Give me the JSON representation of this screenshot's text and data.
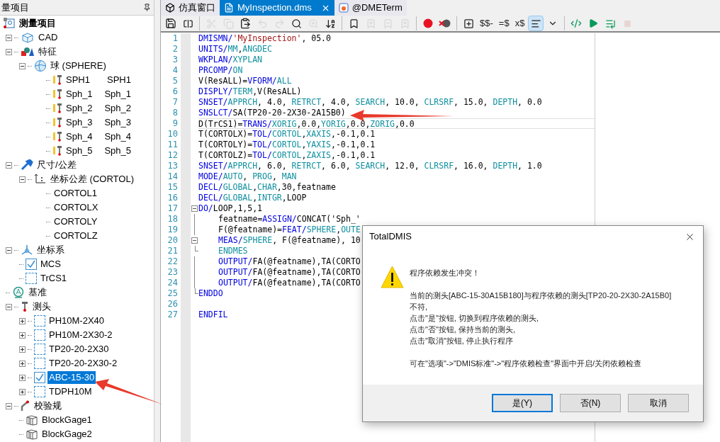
{
  "panel": {
    "title": "量项目"
  },
  "tree": [
    {
      "label": "测量项目",
      "kind": "project",
      "children": [
        {
          "label": "CAD",
          "kind": "cad",
          "expanded": true
        },
        {
          "label": "特征",
          "kind": "feature",
          "expanded": true,
          "children": [
            {
              "label": "球 (SPHERE)",
              "kind": "sphere",
              "expanded": true,
              "children": [
                {
                  "label": "SPH1",
                  "alias": "SPH1",
                  "kind": "point"
                },
                {
                  "label": "Sph_1",
                  "alias": "Sph_1",
                  "kind": "point"
                },
                {
                  "label": "Sph_2",
                  "alias": "Sph_2",
                  "kind": "point"
                },
                {
                  "label": "Sph_3",
                  "alias": "Sph_3",
                  "kind": "point"
                },
                {
                  "label": "Sph_4",
                  "alias": "Sph_4",
                  "kind": "point"
                },
                {
                  "label": "Sph_5",
                  "alias": "Sph_5",
                  "kind": "point"
                }
              ]
            }
          ]
        },
        {
          "label": "尺寸/公差",
          "kind": "tolerance",
          "expanded": true,
          "children": [
            {
              "label": "坐标公差 (CORTOL)",
              "kind": "cortol",
              "expanded": true,
              "children": [
                {
                  "label": "CORTOL1",
                  "kind": "leaf"
                },
                {
                  "label": "CORTOLX",
                  "kind": "leaf"
                },
                {
                  "label": "CORTOLY",
                  "kind": "leaf"
                },
                {
                  "label": "CORTOLZ",
                  "kind": "leaf"
                }
              ]
            }
          ]
        },
        {
          "label": "坐标系",
          "kind": "csys",
          "expanded": true,
          "children": [
            {
              "label": "MCS",
              "kind": "check",
              "checked": true,
              "selected": false
            },
            {
              "label": "TrCS1",
              "kind": "check",
              "checked": false,
              "selected": false
            }
          ]
        },
        {
          "label": "基准",
          "kind": "datum"
        },
        {
          "label": "测头",
          "kind": "probe",
          "expanded": true,
          "children": [
            {
              "label": "PH10M-2X40",
              "kind": "check",
              "checked": false,
              "expanded": false,
              "selected": false
            },
            {
              "label": "PH10M-2X30-2",
              "kind": "check",
              "checked": false,
              "expanded": false,
              "selected": false
            },
            {
              "label": "TP20-20-2X30",
              "kind": "check",
              "checked": false,
              "expanded": false,
              "selected": false
            },
            {
              "label": "TP20-20-2X30-2",
              "kind": "check",
              "checked": false,
              "expanded": false,
              "selected": false
            },
            {
              "label": "ABC-15-30",
              "kind": "check",
              "checked": true,
              "expanded": false,
              "selected": true
            },
            {
              "label": "TDPH10M",
              "kind": "check",
              "checked": false,
              "expanded": false,
              "selected": false
            }
          ]
        },
        {
          "label": "校验规",
          "kind": "gauge",
          "expanded": true,
          "children": [
            {
              "label": "BlockGage1",
              "kind": "block"
            },
            {
              "label": "BlockGage2",
              "kind": "block"
            }
          ]
        }
      ]
    }
  ],
  "tabs": [
    {
      "label": "仿真窗口",
      "kind": "sim",
      "selected": false
    },
    {
      "label": "MyInspection.dms",
      "kind": "doc",
      "selected": true,
      "closable": true
    },
    {
      "label": "@DMETerm",
      "kind": "term",
      "selected": false
    }
  ],
  "toolbar": [
    {
      "kind": "save",
      "disabled": false
    },
    {
      "kind": "compare",
      "disabled": false
    },
    {
      "kind": "sep"
    },
    {
      "kind": "cut",
      "disabled": true
    },
    {
      "kind": "copy",
      "disabled": true
    },
    {
      "kind": "paste",
      "disabled": false
    },
    {
      "kind": "undo",
      "disabled": true
    },
    {
      "kind": "redo",
      "disabled": true
    },
    {
      "kind": "find",
      "disabled": false
    },
    {
      "kind": "findnext",
      "disabled": true
    },
    {
      "kind": "sort",
      "disabled": false
    },
    {
      "kind": "sep"
    },
    {
      "kind": "bookmark",
      "disabled": false
    },
    {
      "kind": "bmprev",
      "disabled": true
    },
    {
      "kind": "bmnext",
      "disabled": true
    },
    {
      "kind": "bmclear",
      "disabled": true
    },
    {
      "kind": "sep"
    },
    {
      "kind": "record",
      "disabled": false
    },
    {
      "kind": "bpdelete",
      "disabled": false
    },
    {
      "kind": "sep"
    },
    {
      "kind": "insert",
      "disabled": false
    },
    {
      "kind": "text",
      "label": "$$-",
      "disabled": false
    },
    {
      "kind": "text",
      "label": "=$",
      "disabled": false
    },
    {
      "kind": "text",
      "label": "x$",
      "disabled": false
    },
    {
      "kind": "align",
      "disabled": false,
      "active": true
    },
    {
      "kind": "dropdown",
      "disabled": false
    },
    {
      "kind": "sep"
    },
    {
      "kind": "code",
      "disabled": false
    },
    {
      "kind": "play",
      "disabled": false
    },
    {
      "kind": "step",
      "disabled": false
    },
    {
      "kind": "stop",
      "disabled": true
    }
  ],
  "code": [
    {
      "n": "1",
      "tokens": [
        {
          "t": "DMISMN/",
          "kind": "kw"
        },
        {
          "t": "'MyInspection'",
          "kind": "str"
        },
        {
          "t": ", 05.0",
          "kind": "p"
        }
      ]
    },
    {
      "n": "2",
      "tokens": [
        {
          "t": "UNITS/",
          "kind": "kw"
        },
        {
          "t": "MM",
          "kind": "at"
        },
        {
          "t": ",",
          "kind": "p"
        },
        {
          "t": "ANGDEC",
          "kind": "at"
        }
      ]
    },
    {
      "n": "3",
      "tokens": [
        {
          "t": "WKPLAN/",
          "kind": "kw"
        },
        {
          "t": "XYPLAN",
          "kind": "at"
        }
      ]
    },
    {
      "n": "4",
      "tokens": [
        {
          "t": "PRCOMP/",
          "kind": "kw"
        },
        {
          "t": "ON",
          "kind": "at"
        }
      ]
    },
    {
      "n": "5",
      "tokens": [
        {
          "t": "V(ResALL)=",
          "kind": "p"
        },
        {
          "t": "VFORM/",
          "kind": "kw"
        },
        {
          "t": "ALL",
          "kind": "at"
        }
      ]
    },
    {
      "n": "6",
      "tokens": [
        {
          "t": "DISPLY/",
          "kind": "kw"
        },
        {
          "t": "TERM",
          "kind": "at"
        },
        {
          "t": ",V(ResALL)",
          "kind": "p"
        }
      ]
    },
    {
      "n": "7",
      "tokens": [
        {
          "t": "SNSET/",
          "kind": "kw"
        },
        {
          "t": "APPRCH",
          "kind": "at"
        },
        {
          "t": ", 4.0, ",
          "kind": "p"
        },
        {
          "t": "RETRCT",
          "kind": "at"
        },
        {
          "t": ", 4.0, ",
          "kind": "p"
        },
        {
          "t": "SEARCH",
          "kind": "at"
        },
        {
          "t": ", 10.0, ",
          "kind": "p"
        },
        {
          "t": "CLRSRF",
          "kind": "at"
        },
        {
          "t": ", 15.0, ",
          "kind": "p"
        },
        {
          "t": "DEPTH",
          "kind": "at"
        },
        {
          "t": ", 0.0",
          "kind": "p"
        }
      ]
    },
    {
      "n": "8",
      "tokens": [
        {
          "t": "SNSLCT/",
          "kind": "kw"
        },
        {
          "t": "SA(TP20-20-2X30-2A15B0)",
          "kind": "p"
        }
      ]
    },
    {
      "n": "9",
      "current": true,
      "tokens": [
        {
          "t": "D(TrCS1)=",
          "kind": "p"
        },
        {
          "t": "TRANS/",
          "kind": "kw"
        },
        {
          "t": "XORIG",
          "kind": "at"
        },
        {
          "t": ",0.0,",
          "kind": "p"
        },
        {
          "t": "YORIG",
          "kind": "at"
        },
        {
          "t": ",0.0,",
          "kind": "p"
        },
        {
          "t": "ZORIG",
          "kind": "at"
        },
        {
          "t": ",0.0",
          "kind": "p"
        }
      ]
    },
    {
      "n": "10",
      "tokens": [
        {
          "t": "T(CORTOLX)=",
          "kind": "p"
        },
        {
          "t": "TOL/",
          "kind": "kw"
        },
        {
          "t": "CORTOL",
          "kind": "at"
        },
        {
          "t": ",",
          "kind": "p"
        },
        {
          "t": "XAXIS",
          "kind": "at"
        },
        {
          "t": ",-0.1,0.1",
          "kind": "p"
        }
      ]
    },
    {
      "n": "11",
      "tokens": [
        {
          "t": "T(CORTOLY)=",
          "kind": "p"
        },
        {
          "t": "TOL/",
          "kind": "kw"
        },
        {
          "t": "CORTOL",
          "kind": "at"
        },
        {
          "t": ",",
          "kind": "p"
        },
        {
          "t": "YAXIS",
          "kind": "at"
        },
        {
          "t": ",-0.1,0.1",
          "kind": "p"
        }
      ]
    },
    {
      "n": "12",
      "tokens": [
        {
          "t": "T(CORTOLZ)=",
          "kind": "p"
        },
        {
          "t": "TOL/",
          "kind": "kw"
        },
        {
          "t": "CORTOL",
          "kind": "at"
        },
        {
          "t": ",",
          "kind": "p"
        },
        {
          "t": "ZAXIS",
          "kind": "at"
        },
        {
          "t": ",-0.1,0.1",
          "kind": "p"
        }
      ]
    },
    {
      "n": "13",
      "tokens": [
        {
          "t": "SNSET/",
          "kind": "kw"
        },
        {
          "t": "APPRCH",
          "kind": "at"
        },
        {
          "t": ", 6.0, ",
          "kind": "p"
        },
        {
          "t": "RETRCT",
          "kind": "at"
        },
        {
          "t": ", 6.0, ",
          "kind": "p"
        },
        {
          "t": "SEARCH",
          "kind": "at"
        },
        {
          "t": ", 12.0, ",
          "kind": "p"
        },
        {
          "t": "CLRSRF",
          "kind": "at"
        },
        {
          "t": ", 16.0, ",
          "kind": "p"
        },
        {
          "t": "DEPTH",
          "kind": "at"
        },
        {
          "t": ", 1.0",
          "kind": "p"
        }
      ]
    },
    {
      "n": "14",
      "tokens": [
        {
          "t": "MODE/",
          "kind": "kw"
        },
        {
          "t": "AUTO",
          "kind": "at"
        },
        {
          "t": ", ",
          "kind": "p"
        },
        {
          "t": "PROG",
          "kind": "at"
        },
        {
          "t": ", ",
          "kind": "p"
        },
        {
          "t": "MAN",
          "kind": "at"
        }
      ]
    },
    {
      "n": "15",
      "tokens": [
        {
          "t": "DECL/",
          "kind": "kw"
        },
        {
          "t": "GLOBAL",
          "kind": "at"
        },
        {
          "t": ",",
          "kind": "p"
        },
        {
          "t": "CHAR",
          "kind": "at"
        },
        {
          "t": ",30,featname",
          "kind": "p"
        }
      ]
    },
    {
      "n": "16",
      "tokens": [
        {
          "t": "DECL/",
          "kind": "kw"
        },
        {
          "t": "GLOBAL",
          "kind": "at"
        },
        {
          "t": ",",
          "kind": "p"
        },
        {
          "t": "INTGR",
          "kind": "at"
        },
        {
          "t": ",LOOP",
          "kind": "p"
        }
      ]
    },
    {
      "n": "17",
      "fold": {
        "kind": "open"
      },
      "tokens": [
        {
          "t": "DO/",
          "kind": "kw"
        },
        {
          "t": "LOOP,1,5,1",
          "kind": "p"
        }
      ]
    },
    {
      "n": "18",
      "fold": {
        "kind": "line"
      },
      "indented": true,
      "tokens": [
        {
          "t": "featname=",
          "kind": "p"
        },
        {
          "t": "ASSIGN/",
          "kind": "kw"
        },
        {
          "t": "CONCAT('Sph_'",
          "kind": "p"
        }
      ]
    },
    {
      "n": "19",
      "fold": {
        "kind": "line"
      },
      "indented": true,
      "tokens": [
        {
          "t": "F(@featname)=",
          "kind": "p"
        },
        {
          "t": "FEAT/",
          "kind": "kw"
        },
        {
          "t": "SPHERE",
          "kind": "at"
        },
        {
          "t": ",",
          "kind": "p"
        },
        {
          "t": "OUTE",
          "kind": "at"
        }
      ]
    },
    {
      "n": "20",
      "fold": {
        "kind": "open"
      },
      "indented": true,
      "tokens": [
        {
          "t": "MEAS/",
          "kind": "kw"
        },
        {
          "t": "SPHERE",
          "kind": "at"
        },
        {
          "t": ", F(@featname), 10",
          "kind": "p"
        }
      ]
    },
    {
      "n": "21",
      "fold": {
        "kind": "end"
      },
      "indented": true,
      "tokens": [
        {
          "t": "ENDMES",
          "kind": "at"
        }
      ]
    },
    {
      "n": "22",
      "fold": {
        "kind": "line"
      },
      "indented": true,
      "tokens": [
        {
          "t": "OUTPUT/",
          "kind": "kw"
        },
        {
          "t": "FA(@featname),TA(CORTO",
          "kind": "p"
        }
      ]
    },
    {
      "n": "23",
      "fold": {
        "kind": "line"
      },
      "indented": true,
      "tokens": [
        {
          "t": "OUTPUT/",
          "kind": "kw"
        },
        {
          "t": "FA(@featname),TA(CORTO",
          "kind": "p"
        }
      ]
    },
    {
      "n": "24",
      "fold": {
        "kind": "line"
      },
      "indented": true,
      "tokens": [
        {
          "t": "OUTPUT/",
          "kind": "kw"
        },
        {
          "t": "FA(@featname),TA(CORTO",
          "kind": "p"
        }
      ]
    },
    {
      "n": "25",
      "fold": {
        "kind": "end"
      },
      "tokens": [
        {
          "t": "ENDDO",
          "kind": "kw"
        }
      ]
    },
    {
      "n": "26"
    },
    {
      "n": "27",
      "tokens": [
        {
          "t": "ENDFIL",
          "kind": "kw"
        }
      ]
    }
  ],
  "dialog": {
    "title": "TotalDMIS",
    "heading": "程序依赖发生冲突！",
    "lines": [
      "当前的测头[ABC-15-30A15B180]与程序依赖的测头[TP20-20-2X30-2A15B0]",
      "不符,",
      "点击\"是\"按钮, 切换到程序依赖的测头,",
      "点击\"否\"按钮, 保持当前的测头,",
      "点击\"取消\"按钮, 停止执行程序"
    ],
    "note": "可在\"选项\"->\"DMIS标准\"->\"程序依赖检查\"界面中开启/关闭依赖检查",
    "buttons": [
      {
        "label": "是(Y)",
        "focused": true
      },
      {
        "label": "否(N)",
        "focused": false
      },
      {
        "label": "取消",
        "focused": false
      }
    ]
  }
}
